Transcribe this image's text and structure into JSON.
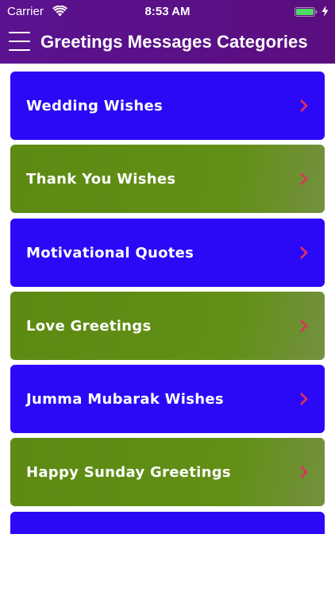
{
  "status_bar": {
    "carrier": "Carrier",
    "time": "8:53 AM",
    "icons": [
      "wifi-icon",
      "battery-icon",
      "charging-icon"
    ]
  },
  "header": {
    "title": "Greetings Messages Categories",
    "menu_icon": "hamburger-menu-icon"
  },
  "colors": {
    "header": "#5a1290",
    "card_blue": "#2b09f6",
    "card_green": "#5c8a12",
    "chevron": "#e0315a"
  },
  "categories": [
    {
      "label": "Wedding Wishes",
      "color": "blue"
    },
    {
      "label": "Thank You Wishes",
      "color": "green"
    },
    {
      "label": "Motivational Quotes",
      "color": "blue"
    },
    {
      "label": "Love Greetings",
      "color": "green"
    },
    {
      "label": "Jumma Mubarak Wishes",
      "color": "blue"
    },
    {
      "label": "Happy Sunday Greetings",
      "color": "green"
    },
    {
      "label": "",
      "color": "blue"
    }
  ]
}
